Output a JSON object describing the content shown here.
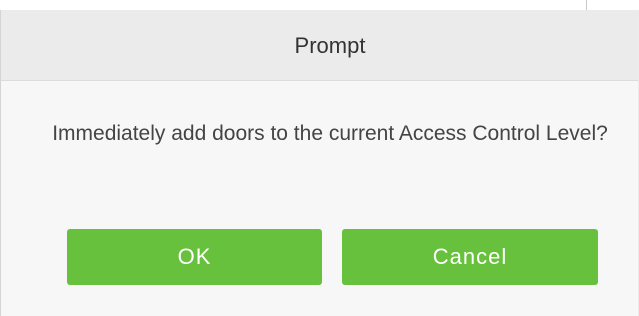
{
  "dialog": {
    "title": "Prompt",
    "message": "Immediately add doors to the current Access Control Level?",
    "ok_label": "OK",
    "cancel_label": "Cancel"
  },
  "colors": {
    "button_green": "#67c13c",
    "titlebar_bg": "#ebebeb",
    "dialog_bg": "#f7f7f7"
  }
}
